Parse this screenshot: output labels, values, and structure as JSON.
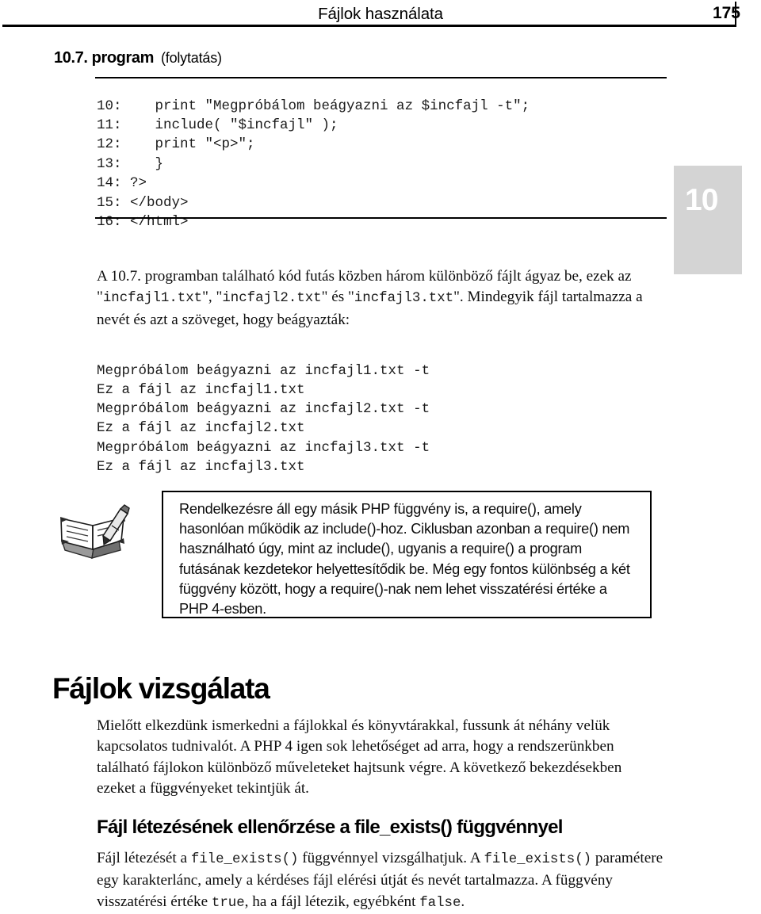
{
  "header": {
    "title": "Fájlok használata",
    "page_number": "175"
  },
  "chapter_tab": {
    "number": "10"
  },
  "program_caption": {
    "title": "10.7. program",
    "subtitle": "(folytatás)"
  },
  "code_listing": "10:    print \"Megpróbálom beágyazni az $incfajl -t\";\n11:    include( \"$incfajl\" );\n12:    print \"<p>\";\n13:    }\n14: ?>\n15: </body>\n16: </html>",
  "intro_paragraph": {
    "line1_a": "A 10.7. programban található kód futás közben három különböző fájlt ágyaz be,",
    "line2_a": "ezek az \"",
    "code1": "incfajl1.txt",
    "line2_b": "\", \"",
    "code2": "incfajl2.txt",
    "line2_c": "\" és \"",
    "code3": "incfajl3.txt",
    "line2_d": "\".",
    "line3_a": "Mindegyik fájl tartalmazza a nevét és azt a szöveget, hogy beágyazták:"
  },
  "output_listing": "Megpróbálom beágyazni az incfajl1.txt -t\nEz a fájl az incfajl1.txt\nMegpróbálom beágyazni az incfajl2.txt -t\nEz a fájl az incfajl2.txt\nMegpróbálom beágyazni az incfajl3.txt -t\nEz a fájl az incfajl3.txt",
  "note_box": {
    "icon": "notebook-pen-icon",
    "text": "Rendelkezésre áll egy másik PHP függvény is, a require(), amely hasonlóan működik az include()-hoz. Ciklusban azonban a require() nem használható úgy, mint az include(), ugyanis a require() a program futásának kezdetekor helyettesítődik be. Még egy fontos különbség a két függvény között, hogy a require()-nak nem lehet visszatérési értéke a PHP 4-esben."
  },
  "section_heading": "Fájlok vizsgálata",
  "files_paragraph": "Mielőtt elkezdünk ismerkedni a fájlokkal és könyvtárakkal, fussunk át néhány velük kapcsolatos tudnivalót. A PHP 4 igen sok lehetőséget ad arra, hogy a rendszerünkben található fájlokon különböző műveleteket hajtsunk végre. A következő bekezdésekben ezeket a függvényeket tekintjük át.",
  "subsection_heading": "Fájl létezésének ellenőrzése a file_exists() függvénnyel",
  "exists_paragraph": {
    "p1": "Fájl létezését a ",
    "code1": "file_exists()",
    "p2": " függvénnyel vizsgálhatjuk. A ",
    "code2": "file_exists()",
    "p3": " paramétere egy karakterlánc, amely a kérdéses fájl elérési útját és nevét tartalmazza. A függvény visszatérési értéke ",
    "code3": "true",
    "p4": ", ha a fájl létezik, egyébként ",
    "code4": "false",
    "p5": "."
  }
}
